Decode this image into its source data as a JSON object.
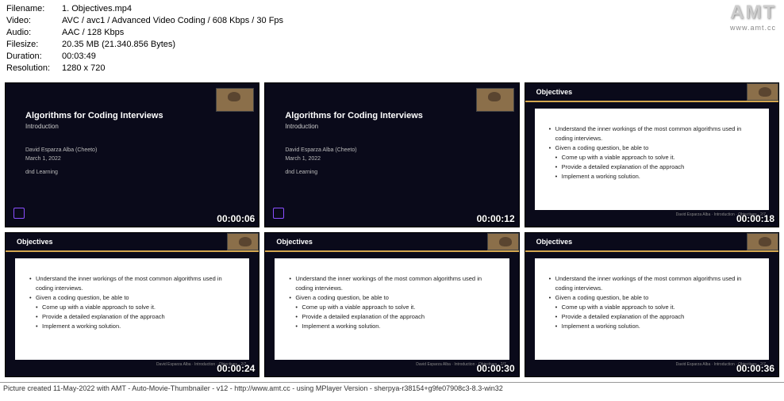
{
  "meta": {
    "labels": {
      "filename": "Filename:",
      "video": "Video:",
      "audio": "Audio:",
      "filesize": "Filesize:",
      "duration": "Duration:",
      "resolution": "Resolution:"
    },
    "values": {
      "filename": "1. Objectives.mp4",
      "video": "AVC / avc1 / Advanced Video Coding / 608 Kbps / 30 Fps",
      "audio": "AAC / 128 Kbps",
      "filesize": "20.35 MB (21.340.856 Bytes)",
      "duration": "00:03:49",
      "resolution": "1280 x 720"
    }
  },
  "logo": {
    "text": "AMT",
    "url": "www.amt.cc"
  },
  "slide_title": {
    "heading": "Algorithms for Coding Interviews",
    "sub": "Introduction",
    "author": "David Esparza Alba (Cheeto)",
    "date": "March 1, 2022",
    "org": "dnd Learning"
  },
  "slide_obj": {
    "header": "Objectives",
    "b1": "Understand the inner workings of the most common algorithms used in",
    "b1b": "coding interviews.",
    "b2": "Given a coding question, be able to",
    "s1": "Come up with a viable approach to solve it.",
    "s2": "Provide a detailed explanation of the approach",
    "s3": "Implement a working solution.",
    "footer": "David Esparza Alba · Introduction · Objectives · 2/7"
  },
  "timestamps": [
    "00:00:06",
    "00:00:12",
    "00:00:18",
    "00:00:24",
    "00:00:30",
    "00:00:36"
  ],
  "footer": "Picture created 11-May-2022 with AMT - Auto-Movie-Thumbnailer - v12 - http://www.amt.cc - using MPlayer Version - sherpya-r38154+g9fe07908c3-8.3-win32"
}
